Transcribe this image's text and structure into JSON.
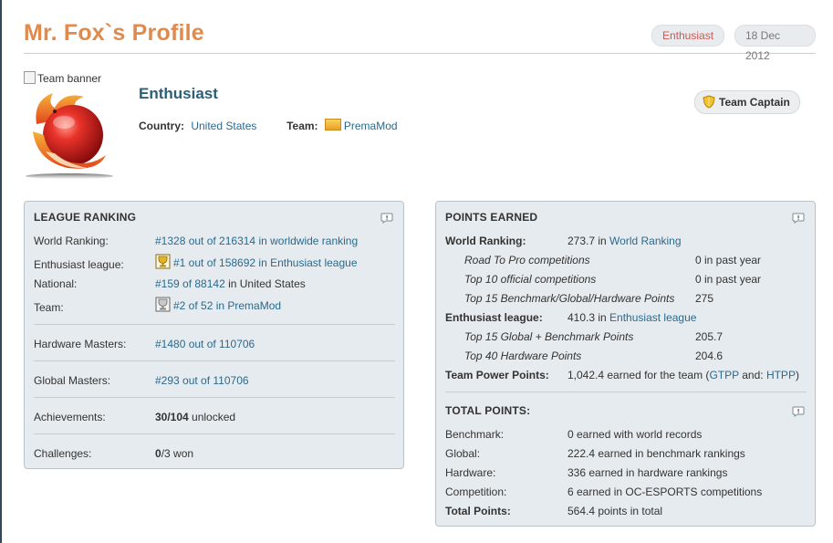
{
  "header": {
    "title": "Mr. Fox`s Profile",
    "league_badge": "Enthusiast",
    "date": "18 Dec 2012"
  },
  "profile": {
    "banner_alt": "Team banner",
    "rank_title": "Enthusiast",
    "country_label": "Country:",
    "country": "United States",
    "team_label": "Team:",
    "team": "PremaMod",
    "role_badge": "Team Captain"
  },
  "league_ranking": {
    "title": "LEAGUE RANKING",
    "rows": [
      {
        "label": "World Ranking:",
        "link": "#1328 out of 216314 in worldwide ranking"
      },
      {
        "label": "Enthusiast league:",
        "link": "#1 out of 158692 in Enthusiast league"
      },
      {
        "label": "National:",
        "link": "#159 of 88142",
        "text": " in United States"
      },
      {
        "label": "Team:",
        "link": "#2 of 52 in PremaMod"
      },
      {
        "label": "Hardware Masters:",
        "link": "#1480 out of 110706"
      },
      {
        "label": "Global Masters:",
        "link": "#293 out of 110706"
      },
      {
        "label": "Achievements:",
        "bold": "30/104",
        "text": " unlocked"
      },
      {
        "label": "Challenges:",
        "bold": "0",
        "text": "/3 won"
      }
    ]
  },
  "points_earned": {
    "title": "POINTS EARNED",
    "world_label": "World Ranking:",
    "world_value": "273.7 in ",
    "world_link": "World Ranking",
    "world_items": [
      {
        "label": "Road To Pro competitions",
        "value": "0 in past year"
      },
      {
        "label": "Top 10 official competitions",
        "value": "0 in past year"
      },
      {
        "label": "Top 15 Benchmark/Global/Hardware Points",
        "value": "275"
      }
    ],
    "league_label": "Enthusiast league:",
    "league_value": "410.3 in ",
    "league_link": "Enthusiast league",
    "league_items": [
      {
        "label": "Top 15 Global + Benchmark Points",
        "value": "205.7"
      },
      {
        "label": "Top 40 Hardware Points",
        "value": "204.6"
      }
    ],
    "team_label": "Team Power Points:",
    "team_value": "1,042.4 earned for the team (",
    "team_link1": "GTPP",
    "team_mid": " and: ",
    "team_link2": "HTPP",
    "team_end": ")"
  },
  "total_points": {
    "title": "TOTAL POINTS:",
    "rows": [
      {
        "label": "Benchmark:",
        "value": "0 earned with world records"
      },
      {
        "label": "Global:",
        "value": "222.4 earned in benchmark rankings"
      },
      {
        "label": "Hardware:",
        "value": "336 earned in hardware rankings"
      },
      {
        "label": "Competition:",
        "value": "6 earned in OC-ESPORTS competitions"
      },
      {
        "label": "Total Points:",
        "value": "564.4 points in total"
      }
    ]
  },
  "icons": {
    "help": "help-bubble-icon",
    "shield": "shield-icon",
    "trophy": "trophy-icon",
    "flag": "team-flag-icon",
    "avatar": "fox-avatar-icon"
  }
}
